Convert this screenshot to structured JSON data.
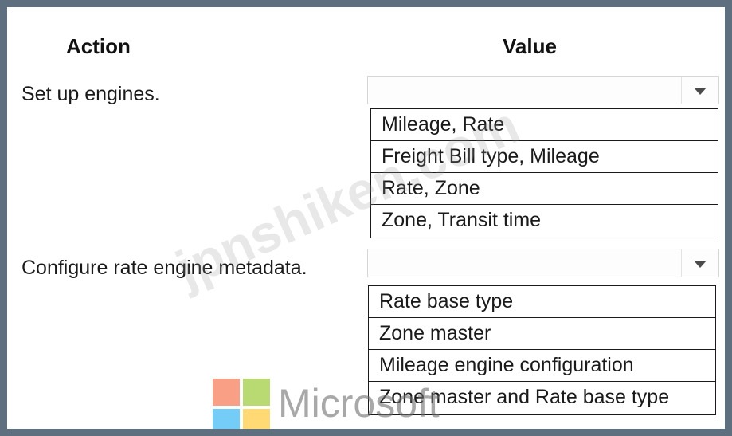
{
  "headers": {
    "action": "Action",
    "value": "Value"
  },
  "rows": [
    {
      "action": "Set up engines.",
      "dropdown_value": "",
      "options": [
        "Mileage, Rate",
        "Freight Bill type, Mileage",
        "Rate, Zone",
        "Zone, Transit time"
      ]
    },
    {
      "action": "Configure rate engine metadata.",
      "dropdown_value": "",
      "options": [
        "Rate base type",
        "Zone master",
        "Mileage engine configuration",
        "Zone master and Rate base type"
      ]
    }
  ],
  "watermark": {
    "text": "jpnshiken.com",
    "logo_text": "Microsoft"
  },
  "colors": {
    "frame_border": "#5e6f80",
    "logo_red": "#f25022",
    "logo_green": "#7fba00",
    "logo_blue": "#00a4ef",
    "logo_yellow": "#ffb900"
  },
  "icons": {
    "dropdown_caret": "chevron-down-icon",
    "logo": "microsoft-logo-icon"
  }
}
